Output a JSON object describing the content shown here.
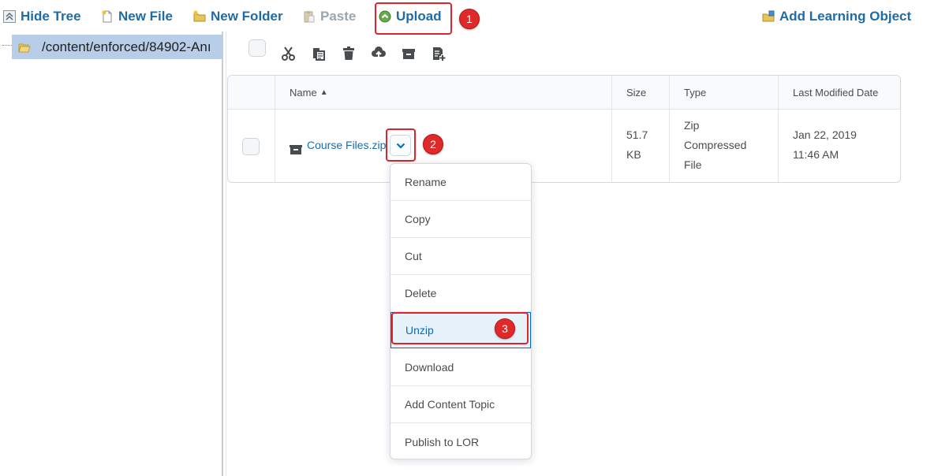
{
  "toolbar": {
    "hide_tree": "Hide Tree",
    "new_file": "New File",
    "new_folder": "New Folder",
    "paste": "Paste",
    "upload": "Upload",
    "add_learning_object": "Add Learning Object"
  },
  "tree": {
    "selected_path": "/content/enforced/84902-Anı"
  },
  "table": {
    "headers": {
      "name": "Name",
      "size": "Size",
      "type": "Type",
      "modified": "Last Modified Date"
    },
    "row": {
      "name": "Course Files.zip",
      "size_line1": "51.7",
      "size_line2": "KB",
      "type_line1": "Zip",
      "type_line2": "Compressed",
      "type_line3": "File",
      "modified_line1": "Jan 22, 2019",
      "modified_line2": "11:46 AM"
    }
  },
  "context_menu": {
    "items": [
      "Rename",
      "Copy",
      "Cut",
      "Delete",
      "Unzip",
      "Download",
      "Add Content Topic",
      "Publish to LOR"
    ]
  },
  "annotations": {
    "step1": "1",
    "step2": "2",
    "step3": "3"
  },
  "colors": {
    "link_blue": "#1d6ca8",
    "annotation_red": "#e0232a",
    "selection_blue": "#b7cde8"
  }
}
